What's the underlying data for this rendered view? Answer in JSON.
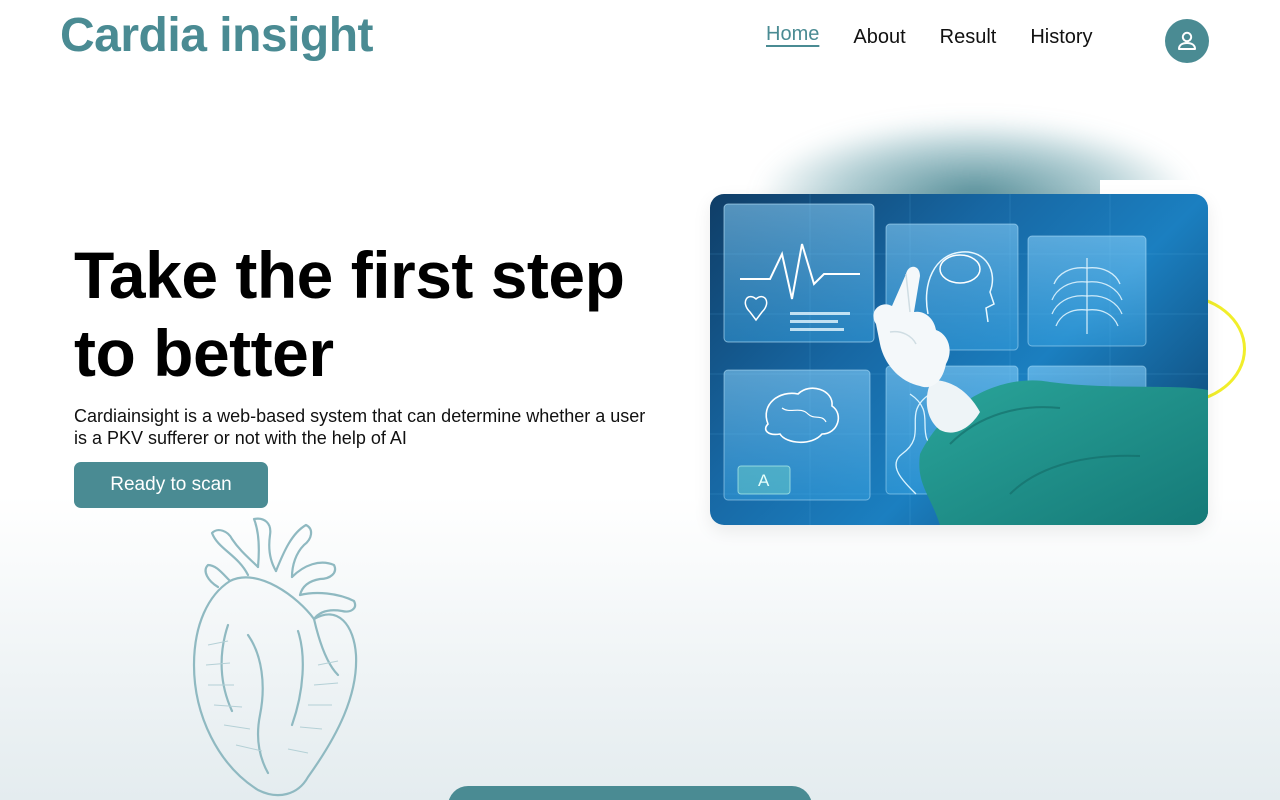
{
  "header": {
    "brand": "Cardia insight",
    "nav": {
      "home": "Home",
      "about": "About",
      "result": "Result",
      "history": "History"
    },
    "active_item": "Home",
    "profile_icon": "user-icon"
  },
  "hero": {
    "title": "Take the first step to better",
    "description": "Cardiainsight is a web-based system that can determine whether a user is a PKV sufferer or not with the help of AI",
    "cta_label": "Ready to scan",
    "image_label": "A"
  },
  "colors": {
    "accent": "#4a8b93",
    "heading": "#000000",
    "ring": "#f1ee2a",
    "surgeon_gown": "#1f8f88"
  },
  "icons": {
    "profile": "user-icon",
    "illustration": "heart-sketch"
  }
}
